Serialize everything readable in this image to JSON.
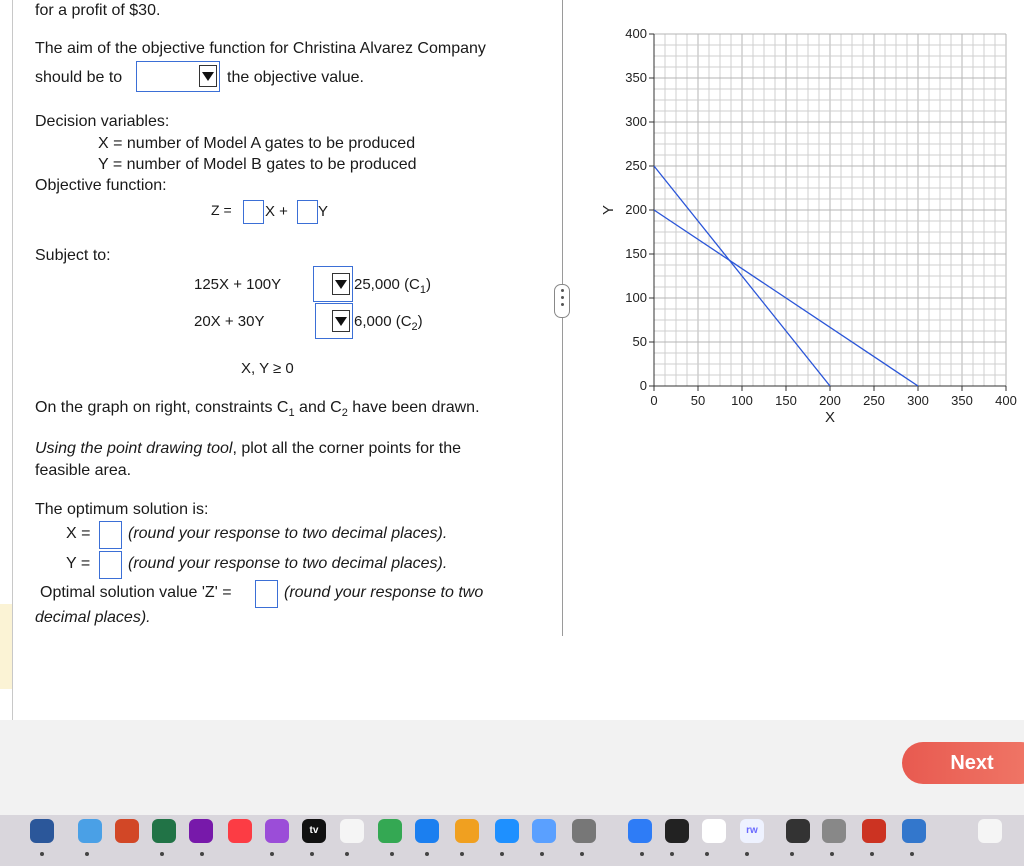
{
  "problem": {
    "profit_line": "for a profit of $30.",
    "aim_line1": "The aim of the objective function for Christina Alvarez Company",
    "aim_line2a": "should be to",
    "aim_line2b": "the objective value.",
    "decision_header": "Decision variables:",
    "var_x": "X = number of Model A gates to be produced",
    "var_y": "Y = number of Model B gates to be produced",
    "objective_header": "Objective function:",
    "z_label": "Z =",
    "x_plus": "X +",
    "y_label": "Y",
    "subject_to": "Subject to:",
    "c1_lhs": "125X + 100Y",
    "c1_rhs": "25,000",
    "c1_tag": "(C",
    "c1_sub": "1",
    "c2_lhs": "20X + 30Y",
    "c2_rhs": "6,000",
    "c2_tag": "(C",
    "c2_sub": "2",
    "nonneg": "X, Y ≥ 0",
    "graph_note_a": "On the graph on right, constraints C",
    "graph_note_sub1": "1",
    "graph_note_b": " and C",
    "graph_note_sub2": "2",
    "graph_note_c": " have been drawn.",
    "tool_note_italic": "Using the point drawing tool",
    "tool_note_rest": ", plot all the corner points for the",
    "tool_note_line2": "feasible area.",
    "optimum_header": "The optimum solution is:",
    "x_eq": "X =",
    "y_eq": "Y =",
    "round_note": "(round your response to two decimal places).",
    "z_opt_label": "Optimal solution value 'Z'  =",
    "round_note_two": "(round your response to two",
    "round_note_two_line2": "decimal places)."
  },
  "chart_data": {
    "type": "line",
    "xlabel": "X",
    "ylabel": "Y",
    "xlim": [
      0,
      400
    ],
    "ylim": [
      0,
      400
    ],
    "x_ticks": [
      0,
      50,
      100,
      150,
      200,
      250,
      300,
      350,
      400
    ],
    "y_ticks": [
      0,
      50,
      100,
      150,
      200,
      250,
      300,
      350,
      400
    ],
    "grid": true,
    "line_color": "#2a55d8",
    "series": [
      {
        "x": [
          0,
          200
        ],
        "y": [
          250,
          0
        ]
      },
      {
        "x": [
          0,
          300
        ],
        "y": [
          200,
          0
        ]
      }
    ]
  },
  "nav": {
    "next_label": "Next"
  },
  "dock": {
    "icons": [
      "word-icon",
      "finder-icon",
      "powerpoint-icon",
      "excel-icon",
      "onenote-icon",
      "music-icon",
      "podcasts-icon",
      "appletv-icon",
      "news-icon",
      "numbers-icon",
      "keynote-icon",
      "pages-icon",
      "appstore-icon",
      "preview-icon",
      "systemsettings-icon",
      "bluetooth-icon",
      "activity-icon",
      "chrome-icon",
      "rw-icon",
      "printer-icon",
      "scanner-icon",
      "photobooth-icon",
      "finder2-icon",
      "trash-icon"
    ],
    "tv_label": "tv",
    "rw_label": "rw"
  }
}
